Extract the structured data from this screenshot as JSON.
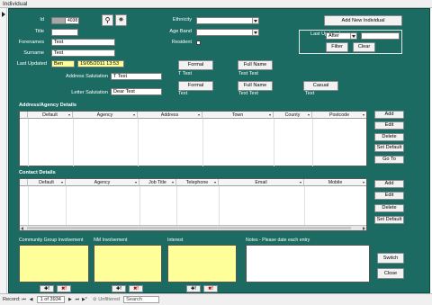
{
  "window": {
    "title": "Individual"
  },
  "header": {
    "id_label": "Id",
    "id_value": "4038",
    "title_label": "Title",
    "title_value": "",
    "forenames_label": "Forenames",
    "forenames_value": "Test",
    "surname_label": "Surname",
    "surname_value": "Test",
    "last_updated_label": "Last Updated",
    "last_updated_by": "Ben",
    "last_updated_at": "19/05/2011 13:53",
    "address_salutation_label": "Address Salutation",
    "address_salutation_value": "T Test",
    "letter_salutation_label": "Letter Salutation",
    "letter_salutation_value": "Dear Test",
    "ethnicity_label": "Ethnicity",
    "ethnicity_value": "",
    "age_band_label": "Age Band",
    "age_band_value": "",
    "resident_label": "Resident"
  },
  "buttons": {
    "add_new": "Add New Individual",
    "formal_1": "Formal",
    "full_name_1": "Full Name",
    "formal_2": "Formal",
    "full_name_2": "Full Name",
    "casual": "Casual",
    "filter": "Filter",
    "clear": "Clear",
    "switch": "Switch",
    "close": "Close"
  },
  "preview": {
    "formal_1": "T Test",
    "full_name_1": "Test Test",
    "formal_2": "Text",
    "full_name_2": "Text Text",
    "casual": "Text"
  },
  "last_updated_filter": {
    "label": "Last Updated",
    "operator": "After",
    "value": ""
  },
  "address": {
    "section_title": "Address/Agency Details",
    "columns": [
      "Default",
      "Agency",
      "Address",
      "Town",
      "County",
      "Postcode"
    ],
    "actions": [
      "Add",
      "Edit",
      "Delete",
      "Set Default",
      "Go To"
    ]
  },
  "contact": {
    "section_title": "Contact Details",
    "columns": [
      "Default",
      "Agency",
      "Job Title",
      "Telephone",
      "Email",
      "Mobile"
    ],
    "actions": [
      "Add",
      "Edit",
      "Delete",
      "Set Default"
    ]
  },
  "bottom": {
    "community_label": "Community Group Involvement",
    "nm_label": "NM Involvement",
    "interest_label": "Interest",
    "notes_label": "Notes - Please date each entry",
    "add_icon_text": "✚!",
    "remove_icon_text": "✖!"
  },
  "record_nav": {
    "label": "Record:",
    "position": "1 of 3934",
    "filter_text": "Unfiltered",
    "search_text": "Search"
  }
}
